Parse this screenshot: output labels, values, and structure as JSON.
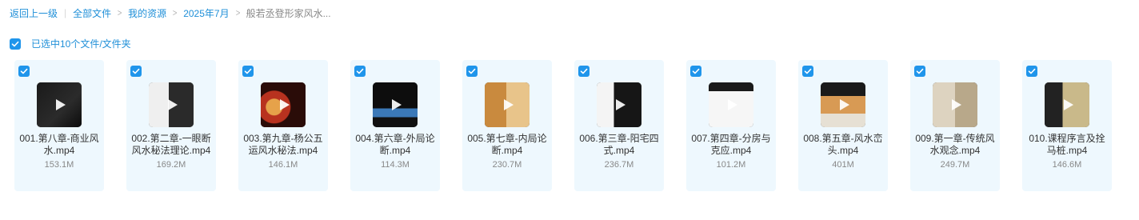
{
  "breadcrumb": {
    "back": "返回上一级",
    "items": [
      "全部文件",
      "我的资源",
      "2025年7月"
    ],
    "current": "般若丞登形家风水..."
  },
  "selection": {
    "label": "已选中10个文件/文件夹"
  },
  "files": [
    {
      "name": "001.第八章-商业风水.mp4",
      "size": "153.1M",
      "thumb": "dark-slide"
    },
    {
      "name": "002.第二章-一眼断风水秘法理论.mp4",
      "size": "169.2M",
      "thumb": "white-slide"
    },
    {
      "name": "003.第九章-杨公五运风水秘法.mp4",
      "size": "146.1M",
      "thumb": "red-compass"
    },
    {
      "name": "004.第六章-外局论断.mp4",
      "size": "114.3M",
      "thumb": "dark-landscape"
    },
    {
      "name": "005.第七章-内局论断.mp4",
      "size": "230.7M",
      "thumb": "interior"
    },
    {
      "name": "006.第三章-阳宅四式.mp4",
      "size": "236.7M",
      "thumb": "white-text"
    },
    {
      "name": "007.第四章-分房与克应.mp4",
      "size": "101.2M",
      "thumb": "floorplan"
    },
    {
      "name": "008.第五章-风水峦头.mp4",
      "size": "401M",
      "thumb": "tan-panel"
    },
    {
      "name": "009.第一章-传统风水观念.mp4",
      "size": "249.7M",
      "thumb": "figure"
    },
    {
      "name": "010.课程序言及拴马桩.mp4",
      "size": "146.6M",
      "thumb": "statue"
    }
  ]
}
